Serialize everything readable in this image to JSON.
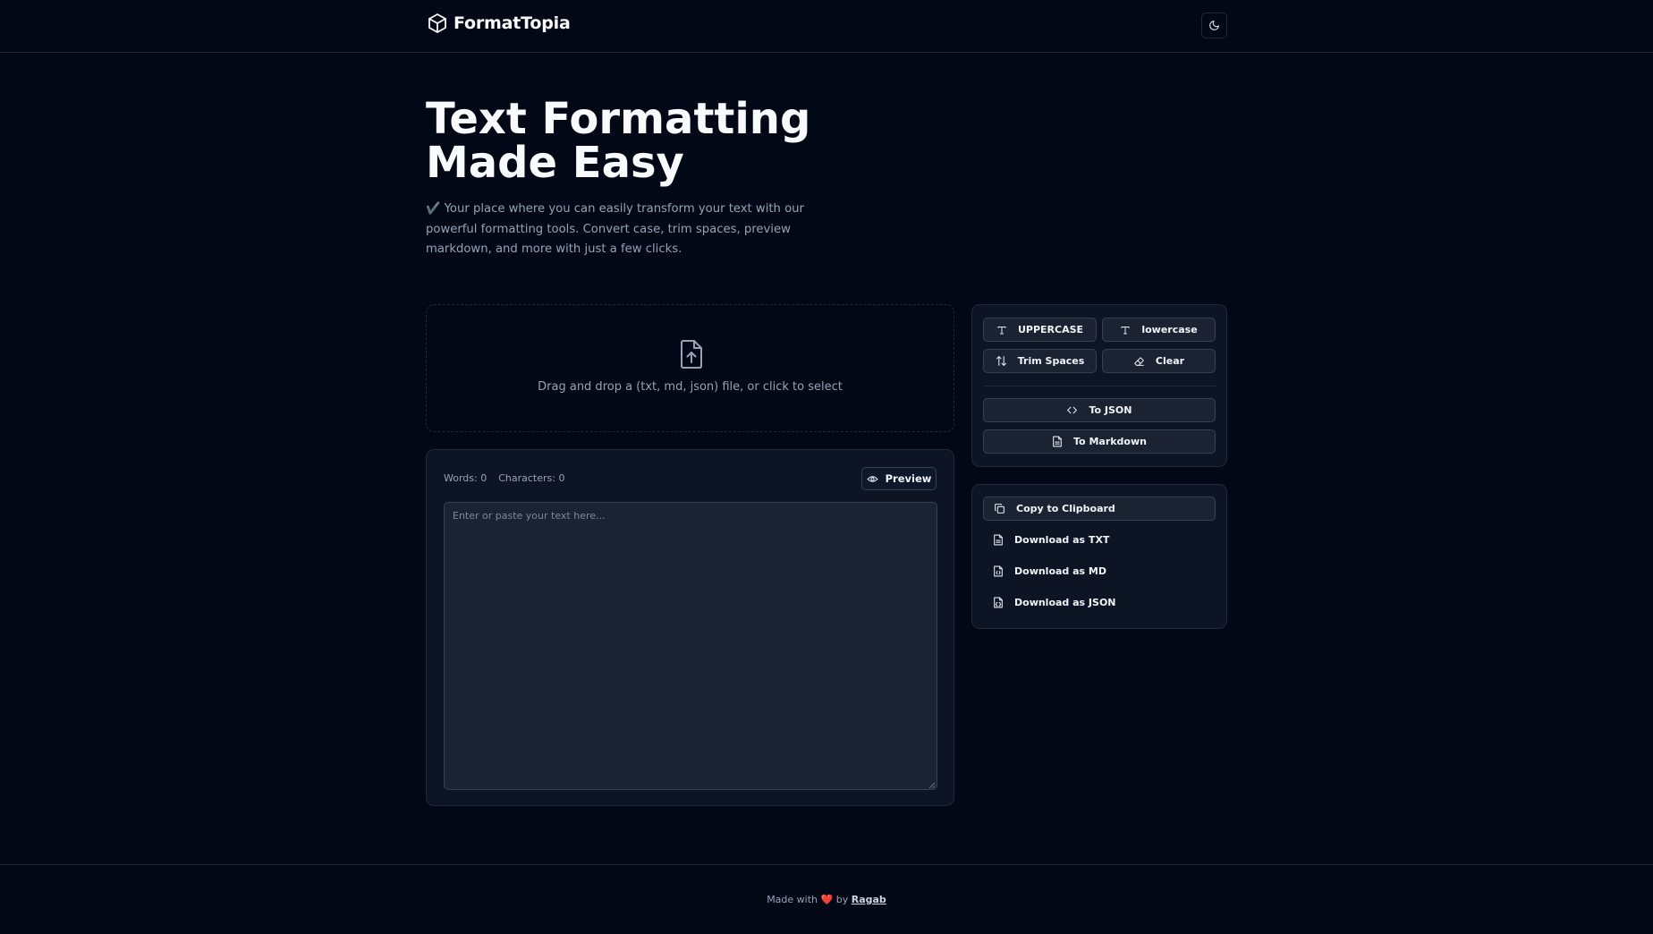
{
  "header": {
    "app_name": "FormatTopia",
    "logo_icon": "cube-icon",
    "theme_toggle_icon": "moon-icon"
  },
  "hero": {
    "title_line1": "Text Formatting",
    "title_line2": "Made Easy",
    "subtitle": "✔️ Your place where you can easily transform your text with our powerful formatting tools. Convert case, trim spaces, preview markdown, and more with just a few clicks."
  },
  "dropzone": {
    "icon": "file-upload-icon",
    "text": "Drag and drop a (txt, md, json) file, or click to select"
  },
  "editor": {
    "words_label": "Words: 0",
    "characters_label": "Characters: 0",
    "preview_label": "Preview",
    "placeholder": "Enter or paste your text here...",
    "value": ""
  },
  "tools": {
    "uppercase_label": "UPPERCASE",
    "lowercase_label": "lowercase",
    "trim_label": "Trim Spaces",
    "clear_label": "Clear",
    "to_json_label": "To JSON",
    "to_markdown_label": "To Markdown"
  },
  "export": {
    "copy_label": "Copy to Clipboard",
    "download_txt_label": "Download as TXT",
    "download_md_label": "Download as MD",
    "download_json_label": "Download as JSON"
  },
  "footer": {
    "made_with": "Made with",
    "heart": "❤️",
    "by": "by",
    "author": "Ragab"
  },
  "colors": {
    "background": "#030817",
    "card": "#0d1424",
    "border": "#1e293b",
    "muted_text": "#94a3b8",
    "heart": "#ef4444"
  }
}
